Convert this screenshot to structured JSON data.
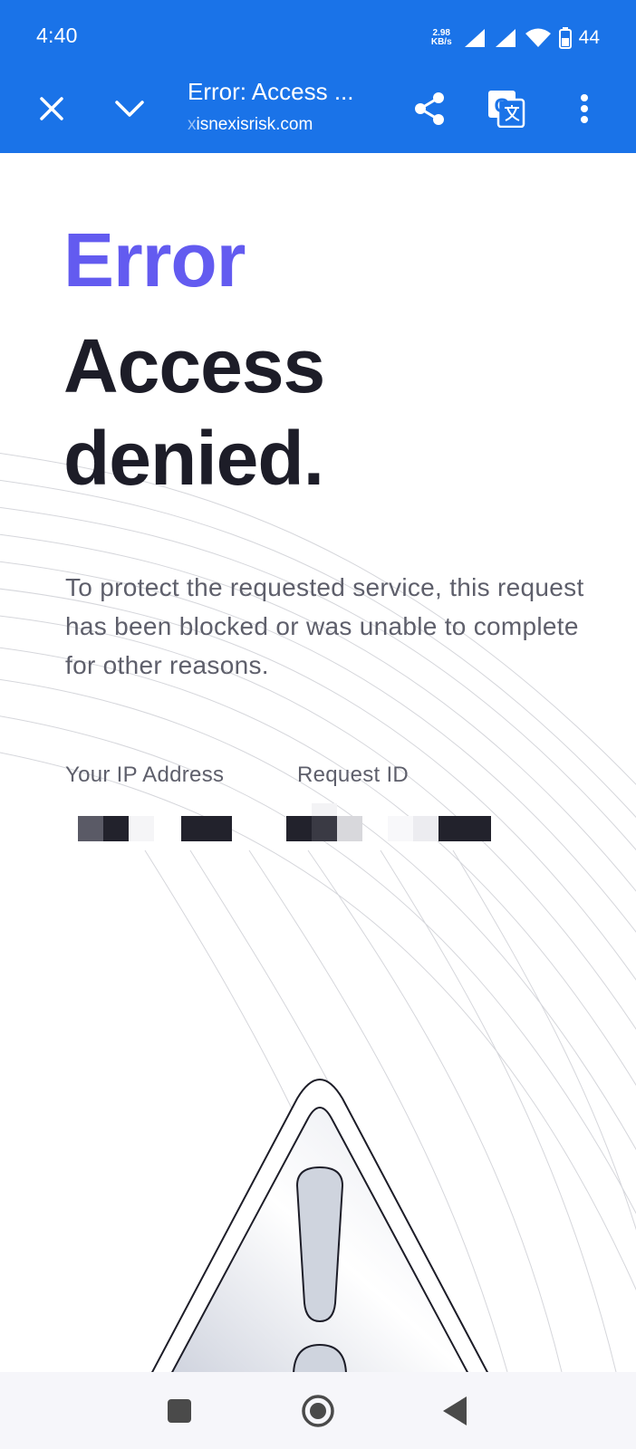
{
  "status_bar": {
    "time": "4:40",
    "net_speed_value": "2.98",
    "net_speed_unit": "KB/s",
    "battery": "44"
  },
  "toolbar": {
    "title": "Error: Access ...",
    "url_prefix": "x",
    "url_main": "isnexisrisk.com",
    "icons": [
      "close-icon",
      "chevron-down-icon",
      "share-icon",
      "translate-icon",
      "more-vert-icon"
    ]
  },
  "page": {
    "error_label": "Error",
    "headline": "Access denied.",
    "description": "To protect the requested service, this request has been blocked or was unable to complete for other reasons.",
    "ip_label": "Your IP Address",
    "request_label": "Request ID"
  },
  "colors": {
    "chrome": "#1a73e8",
    "error_accent": "#635bf0",
    "headline": "#1d1d28",
    "body_text": "#5e5f6b"
  },
  "nav_bar": {
    "icons": [
      "recents-square-icon",
      "home-circle-icon",
      "back-triangle-icon"
    ]
  }
}
